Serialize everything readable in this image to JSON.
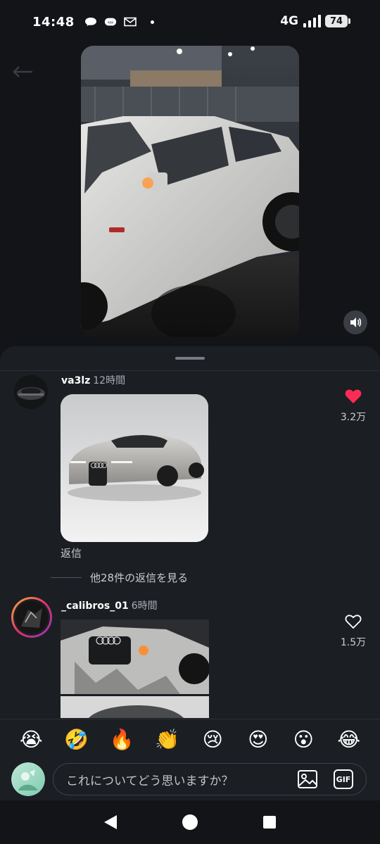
{
  "status_bar": {
    "time": "14:48",
    "network": "4G",
    "battery": "74",
    "notification_icons": [
      "chat-bubble-icon",
      "app-badge-icon",
      "mail-icon"
    ]
  },
  "video": {
    "subject": "white coupe car with damaged front at night",
    "sound_icon": "speaker-icon"
  },
  "comments": [
    {
      "user": "va3lz",
      "time": "12時間",
      "image": "silver concept coupe",
      "like_icon": "heart-filled-icon",
      "likes": "3.2万",
      "reply_label": "返信",
      "view_replies": "他28件の返信を見る"
    },
    {
      "user": "_calibros_01",
      "time": "6時間",
      "image": "crashed car front",
      "like_icon": "heart-outline-icon",
      "likes": "1.5万"
    }
  ],
  "emojis": [
    "😭",
    "🤣",
    "🔥",
    "👏",
    "😢",
    "😍",
    "😮",
    "😂"
  ],
  "composer": {
    "placeholder": "これについてどう思いますか？",
    "gif_label": "GIF"
  },
  "colors": {
    "background": "#121418",
    "sheet": "#1b1e23",
    "like_red": "#fe2c55"
  }
}
